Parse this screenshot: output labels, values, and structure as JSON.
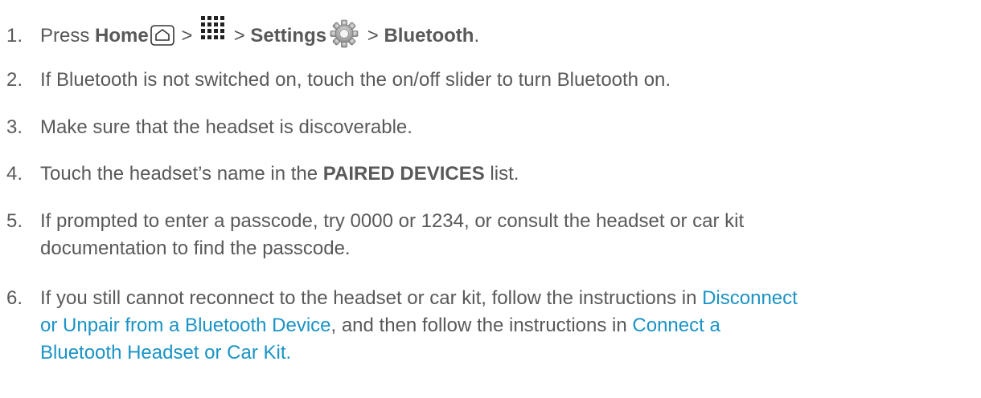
{
  "steps": [
    {
      "num": "1.",
      "press": "Press ",
      "home": "Home",
      "sep1": " > ",
      "sep2": " > ",
      "settings": "Settings",
      "sep3": " > ",
      "bluetooth": "Bluetooth",
      "end": ".",
      "icons": [
        "home-icon",
        "apps-icon",
        "gear-icon"
      ]
    },
    {
      "num": "2.",
      "text": "If Bluetooth is not switched on, touch the on/off slider to turn Bluetooth on."
    },
    {
      "num": "3.",
      "text": "Make sure that the headset is discoverable."
    },
    {
      "num": "4.",
      "pre": "Touch the headset’s name in the ",
      "bold": "PAIRED DEVICES",
      "post": " list."
    },
    {
      "num": "5.",
      "line1": "If prompted to enter a passcode, try 0000 or 1234, or consult the headset or car kit",
      "line2": "documentation to find the passcode."
    },
    {
      "num": "6.",
      "line1_pre": "If you still cannot reconnect to the headset or car kit, follow the instructions in ",
      "link1_part1": "Disconnect",
      "link1_part2": "or Unpair from a Bluetooth Device",
      "mid": ", and then follow the instructions in ",
      "link2_part1": "Connect a",
      "link2_part2": "Bluetooth Headset or Car Kit."
    }
  ],
  "colors": {
    "text": "#595959",
    "link": "#1a93c5"
  }
}
